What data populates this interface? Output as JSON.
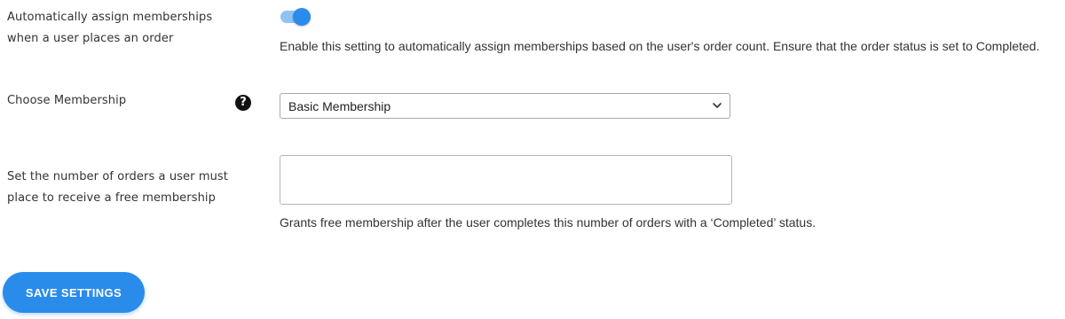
{
  "auto_assign": {
    "label_line1": "Automatically assign memberships",
    "label_line2": "when a user places an order",
    "enabled": true,
    "help_text": "Enable this setting to automatically assign memberships based on the user's order count. Ensure that the order status is set to Completed."
  },
  "choose_membership": {
    "label": "Choose Membership",
    "help_icon": "question-circle-icon",
    "selected_value": "Basic Membership"
  },
  "order_count": {
    "label_line1": "Set the number of orders a user must",
    "label_line2": "place to receive a free membership",
    "value": "",
    "help_text": "Grants free membership after the user completes this number of orders with a ‘Completed’ status."
  },
  "save_button": {
    "label": "SAVE SETTINGS"
  },
  "colors": {
    "accent": "#2a8cea",
    "toggle_track": "#90c3f5"
  }
}
